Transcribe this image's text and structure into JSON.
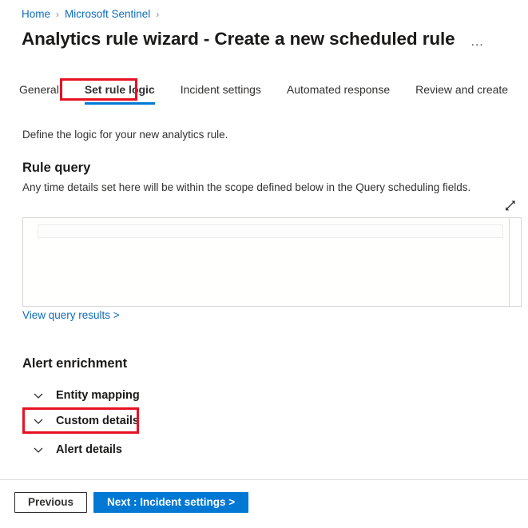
{
  "breadcrumb": {
    "items": [
      {
        "label": "Home"
      },
      {
        "label": "Microsoft Sentinel"
      }
    ],
    "separator": "›"
  },
  "header": {
    "title": "Analytics rule wizard - Create a new scheduled rule",
    "more_menu": "…",
    "more_menu_icon": "ellipsis-icon"
  },
  "tabs": [
    {
      "label": "General",
      "active": false
    },
    {
      "label": "Set rule logic",
      "active": true
    },
    {
      "label": "Incident settings",
      "active": false
    },
    {
      "label": "Automated response",
      "active": false
    },
    {
      "label": "Review and create",
      "active": false
    }
  ],
  "main": {
    "intro": "Define the logic for your new analytics rule.",
    "rule_query": {
      "heading": "Rule query",
      "description": "Any time details set here will be within the scope defined below in the Query scheduling fields.",
      "expand_icon": "expand-diagonal-icon",
      "editor_value": "",
      "editor_placeholder": "",
      "view_results_link": "View query results >"
    },
    "alert_enrichment": {
      "heading": "Alert enrichment",
      "sections": [
        {
          "label": "Entity mapping",
          "icon": "chevron-down-icon",
          "expanded": false
        },
        {
          "label": "Custom details",
          "icon": "chevron-down-icon",
          "expanded": false
        },
        {
          "label": "Alert details",
          "icon": "chevron-down-icon",
          "expanded": false
        }
      ]
    }
  },
  "footer": {
    "previous_label": "Previous",
    "next_label": "Next : Incident settings >"
  },
  "annotations": [
    {
      "target": "Set rule logic",
      "color": "#e81123"
    },
    {
      "target": "Custom details",
      "color": "#e81123"
    }
  ],
  "colors": {
    "accent": "#0078d4",
    "link": "#0f6cbd",
    "annotation": "#e81123",
    "text": "#323130",
    "heading": "#1b1a19"
  }
}
